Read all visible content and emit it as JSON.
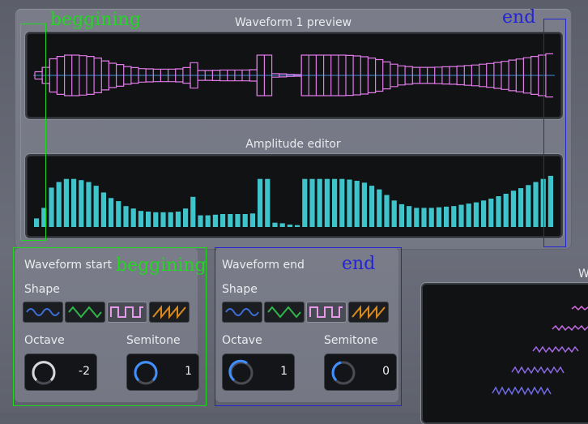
{
  "preview": {
    "title": "Waveform 1 preview"
  },
  "amplitude": {
    "title": "Amplitude editor",
    "bar_levels": [
      0.14,
      0.31,
      0.64,
      0.73,
      0.78,
      0.78,
      0.76,
      0.73,
      0.67,
      0.56,
      0.47,
      0.42,
      0.34,
      0.3,
      0.26,
      0.25,
      0.24,
      0.24,
      0.24,
      0.25,
      0.3,
      0.49,
      0.19,
      0.19,
      0.2,
      0.21,
      0.21,
      0.21,
      0.21,
      0.22,
      0.78,
      0.78,
      0.07,
      0.06,
      0.04,
      0.03,
      0.78,
      0.78,
      0.78,
      0.78,
      0.78,
      0.78,
      0.77,
      0.75,
      0.72,
      0.67,
      0.61,
      0.52,
      0.43,
      0.37,
      0.34,
      0.31,
      0.31,
      0.31,
      0.32,
      0.33,
      0.34,
      0.36,
      0.38,
      0.4,
      0.43,
      0.46,
      0.5,
      0.54,
      0.59,
      0.63,
      0.68,
      0.73,
      0.78,
      0.83
    ]
  },
  "start": {
    "title": "Waveform start",
    "shape_label": "Shape",
    "shapes": [
      "sine",
      "triangle",
      "square",
      "sawtooth"
    ],
    "selected_shape": "square",
    "octave_label": "Octave",
    "octave_value": "-2",
    "semitone_label": "Semitone",
    "semitone_value": "1"
  },
  "end": {
    "title": "Waveform end",
    "shape_label": "Shape",
    "shapes": [
      "sine",
      "triangle",
      "square",
      "sawtooth"
    ],
    "selected_shape": "square",
    "octave_label": "Octave",
    "octave_value": "1",
    "semitone_label": "Semitone",
    "semitone_value": "0"
  },
  "right_panel": {
    "title_visible": "W"
  },
  "annotations": {
    "begin_top": "beggining",
    "end_top": "end",
    "begin_panel": "beggining",
    "end_panel": "end",
    "begin_color": "#22d622",
    "end_color": "#2424d6"
  },
  "colors": {
    "wave": "#e07ae6",
    "bars": "#3fc4cc",
    "center_line": "#3a8fd8",
    "knob_arc": "#3f8fff"
  }
}
